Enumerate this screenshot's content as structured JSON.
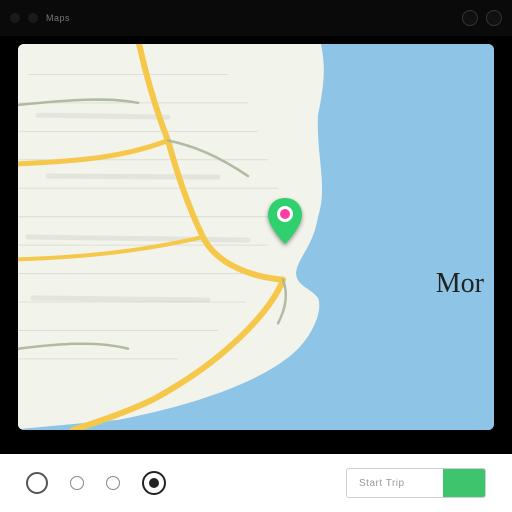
{
  "topbar": {
    "tab_label": "Maps"
  },
  "map": {
    "overlay_text": "Mor",
    "pin": {
      "color": "#2fd06d",
      "inner": "#ff3ea5",
      "label": "location-pin"
    }
  },
  "footer": {
    "chip_label": "Start Trip",
    "accent_color": "#3ec46d"
  },
  "colors": {
    "water": "#8ec5e6",
    "land": "#f2f4ec",
    "road_major": "#f5c84b",
    "road_minor": "#c9ccc1"
  }
}
